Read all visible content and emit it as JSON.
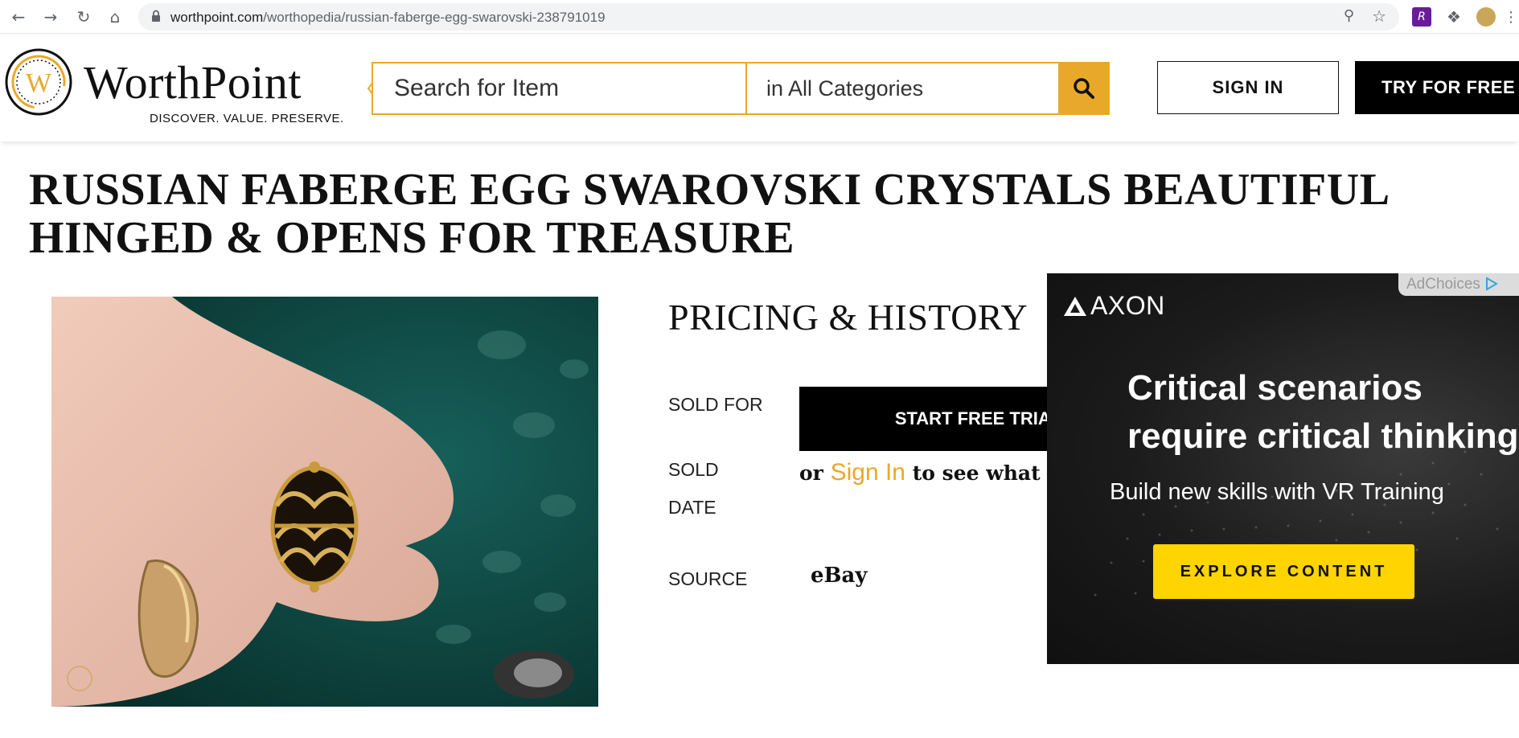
{
  "browser": {
    "url_host": "worthpoint.com",
    "url_path": "/worthopedia/russian-faberge-egg-swarovski-238791019"
  },
  "header": {
    "logo_text": "WorthPoint",
    "tagline": "DISCOVER. VALUE. PRESERVE.",
    "search_placeholder": "Search for Item",
    "category_value": "in All Categories",
    "sign_in_label": "SIGN IN",
    "try_label": "TRY FOR FREE"
  },
  "item": {
    "title": "RUSSIAN FABERGE EGG SWAROVSKI CRYSTALS BEAUTIFUL HINGED & OPENS FOR TREASURE"
  },
  "pricing": {
    "heading": "PRICING & HISTORY",
    "sold_for_label": "SOLD FOR",
    "sold_date_label_1": "SOLD",
    "sold_date_label_2": "DATE",
    "source_label": "SOURCE",
    "source_value": "eBay",
    "start_trial_label": "START FREE TRIAL",
    "or_text": "or",
    "sign_in_link": "Sign In",
    "see_worth_text": "to see what it's worth"
  },
  "ad": {
    "adchoices_label": "AdChoices",
    "brand": "AXON",
    "headline_1": "Critical scenarios",
    "headline_2": "require critical thinking",
    "subline": "Build new skills with VR Training",
    "cta_label": "EXPLORE CONTENT"
  },
  "colors": {
    "brand_gold": "#e8a92a",
    "ad_cta_yellow": "#ffd400"
  }
}
